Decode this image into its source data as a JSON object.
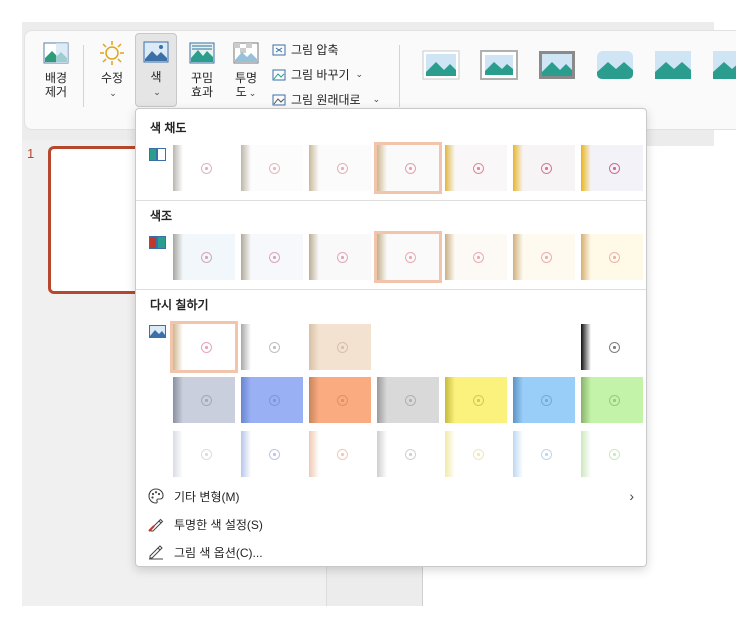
{
  "ribbon": {
    "remove_bg": "배경\n제거",
    "corrections": "수정",
    "color": "색",
    "artistic": "꾸밈\n효과",
    "transparency": "투명\n도",
    "compress": "그림 압축",
    "change": "그림 바꾸기",
    "reset": "그림 원래대로"
  },
  "slide_number": "1",
  "dropdown": {
    "saturation_title": "색 채도",
    "tone_title": "색조",
    "recolor_title": "다시 칠하기",
    "saturation": [
      {
        "strip": "#b9b6b0",
        "bg": "#ffffff",
        "ink": "#d9a0a8"
      },
      {
        "strip": "#bdb7a8",
        "bg": "#fdfcfc",
        "ink": "#e3a6b0"
      },
      {
        "strip": "#c6b89a",
        "bg": "#fcfbfb",
        "ink": "#e49ca9"
      },
      {
        "strip": "#cdb88e",
        "bg": "#fbfafa",
        "ink": "#e4889a"
      },
      {
        "strip": "#e0b640",
        "bg": "#f9f7f7",
        "ink": "#d86e86"
      },
      {
        "strip": "#e7b52a",
        "bg": "#f7f4f6",
        "ink": "#d45a78"
      },
      {
        "strip": "#eab418",
        "bg": "#f3f2f8",
        "ink": "#cb4a6f"
      }
    ],
    "tone": [
      {
        "strip": "#a7a6a0",
        "bg": "#f1f7fb",
        "ink": "#c994a6"
      },
      {
        "strip": "#b1aa98",
        "bg": "#f6f8fb",
        "ink": "#d193a4"
      },
      {
        "strip": "#bbae93",
        "bg": "#faf9fa",
        "ink": "#d895a4"
      },
      {
        "strip": "#c3b08b",
        "bg": "#fbfafa",
        "ink": "#de98a4"
      },
      {
        "strip": "#c9b083",
        "bg": "#fdfaf5",
        "ink": "#e19aa2"
      },
      {
        "strip": "#d0b07c",
        "bg": "#fefaf0",
        "ink": "#e49c9e"
      },
      {
        "strip": "#d6ae73",
        "bg": "#fffae8",
        "ink": "#e7a19c"
      }
    ],
    "recolor_row1": [
      {
        "strip": "#d0b88f",
        "bg": "#ffffff",
        "ink": "#e28ea4"
      },
      {
        "strip": "#a8a8a8",
        "bg": "#ffffff",
        "ink": "#b0b0b0"
      },
      {
        "strip": "#d7c0a6",
        "bg": "#f4e2d0",
        "ink": "#d0b8a0"
      },
      {
        "strip": "#ffffff",
        "bg": "#ffffff",
        "ink": "#ffffff"
      },
      {
        "strip": "#ffffff",
        "bg": "#ffffff",
        "ink": "#ffffff"
      },
      {
        "strip": "#ffffff",
        "bg": "#ffffff",
        "ink": "#ffffff"
      },
      {
        "strip": "#101010",
        "bg": "#ffffff",
        "ink": "#606060"
      }
    ],
    "recolor_row2": [
      {
        "strip": "#8a90a0",
        "bg": "#c9cfdc",
        "ink": "#9aa0b2"
      },
      {
        "strip": "#6a86cf",
        "bg": "#99b0f5",
        "ink": "#7890d8"
      },
      {
        "strip": "#c9845c",
        "bg": "#fbab80",
        "ink": "#d88b62"
      },
      {
        "strip": "#9b9b9b",
        "bg": "#d9d9d9",
        "ink": "#a8a8a8"
      },
      {
        "strip": "#c6bb3e",
        "bg": "#fbf17d",
        "ink": "#ccbf4a"
      },
      {
        "strip": "#5f93c4",
        "bg": "#98cef8",
        "ink": "#6aa2d4"
      },
      {
        "strip": "#8ab06a",
        "bg": "#c2f3a9",
        "ink": "#8cbf6e"
      }
    ],
    "recolor_row3": [
      {
        "strip": "#d8dce4",
        "bg": "#ffffff",
        "ink": "#cfd4dd"
      },
      {
        "strip": "#b8c6ea",
        "bg": "#ffffff",
        "ink": "#a6b8ea"
      },
      {
        "strip": "#efc8b3",
        "bg": "#ffffff",
        "ink": "#f1b9a2"
      },
      {
        "strip": "#cfcfcf",
        "bg": "#ffffff",
        "ink": "#c5c5c5"
      },
      {
        "strip": "#f2eaa8",
        "bg": "#ffffff",
        "ink": "#efe39a"
      },
      {
        "strip": "#bcd8f2",
        "bg": "#ffffff",
        "ink": "#a9cdf2"
      },
      {
        "strip": "#cde7bd",
        "bg": "#ffffff",
        "ink": "#c0e3ab"
      }
    ],
    "more_variations": "기타 변형(M)",
    "set_transparent": "투명한 색 설정(S)",
    "color_options": "그림 색 옵션(C)..."
  }
}
